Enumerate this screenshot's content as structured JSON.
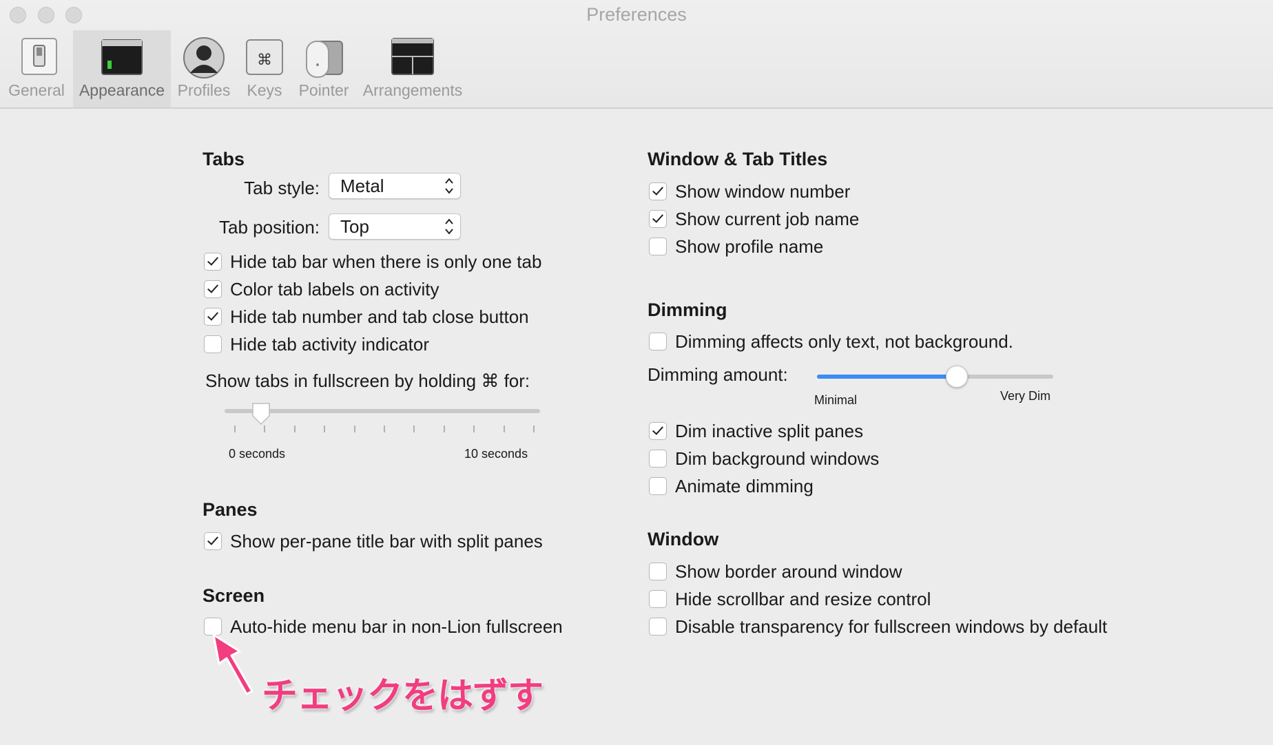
{
  "window": {
    "title": "Preferences"
  },
  "toolbar": {
    "items": [
      {
        "label": "General",
        "icon": "switch-icon",
        "selected": false
      },
      {
        "label": "Appearance",
        "icon": "terminal-window-icon",
        "selected": true
      },
      {
        "label": "Profiles",
        "icon": "person-icon",
        "selected": false
      },
      {
        "label": "Keys",
        "icon": "command-key-icon",
        "selected": false
      },
      {
        "label": "Pointer",
        "icon": "mouse-icon",
        "selected": false
      },
      {
        "label": "Arrangements",
        "icon": "window-arrangement-icon",
        "selected": false
      }
    ]
  },
  "tabs_section": {
    "heading": "Tabs",
    "tab_style_label": "Tab style:",
    "tab_style_value": "Metal",
    "tab_position_label": "Tab position:",
    "tab_position_value": "Top",
    "checkboxes": [
      {
        "label": "Hide tab bar when there is only one tab",
        "checked": true
      },
      {
        "label": "Color tab labels on activity",
        "checked": true
      },
      {
        "label": "Hide tab number and tab close button",
        "checked": true
      },
      {
        "label": "Hide tab activity indicator",
        "checked": false
      }
    ],
    "fullscreen_label": "Show tabs in fullscreen by holding ⌘ for:",
    "slider": {
      "min_label": "0 seconds",
      "max_label": "10 seconds",
      "value_seconds": 1
    }
  },
  "panes_section": {
    "heading": "Panes",
    "checkboxes": [
      {
        "label": "Show per-pane title bar with split panes",
        "checked": true
      }
    ]
  },
  "screen_section": {
    "heading": "Screen",
    "checkboxes": [
      {
        "label": "Auto-hide menu bar in non-Lion fullscreen",
        "checked": false
      }
    ]
  },
  "titles_section": {
    "heading": "Window & Tab Titles",
    "checkboxes": [
      {
        "label": "Show window number",
        "checked": true
      },
      {
        "label": "Show current job name",
        "checked": true
      },
      {
        "label": "Show profile name",
        "checked": false
      }
    ]
  },
  "dimming_section": {
    "heading": "Dimming",
    "checkboxes_top": [
      {
        "label": "Dimming affects only text, not background.",
        "checked": false
      }
    ],
    "amount_label": "Dimming amount:",
    "slider": {
      "min_label": "Minimal",
      "max_label": "Very Dim",
      "value_fraction": 0.6
    },
    "checkboxes": [
      {
        "label": "Dim inactive split panes",
        "checked": true
      },
      {
        "label": "Dim background windows",
        "checked": false
      },
      {
        "label": "Animate dimming",
        "checked": false
      }
    ]
  },
  "window_section": {
    "heading": "Window",
    "checkboxes": [
      {
        "label": "Show border around window",
        "checked": false
      },
      {
        "label": "Hide scrollbar and resize control",
        "checked": false
      },
      {
        "label": "Disable transparency for fullscreen windows by default",
        "checked": false
      }
    ]
  },
  "annotation": {
    "text": "チェックをはずす",
    "color": "#f23d80"
  },
  "colors": {
    "accent": "#3b8cf3",
    "background": "#ececec"
  }
}
